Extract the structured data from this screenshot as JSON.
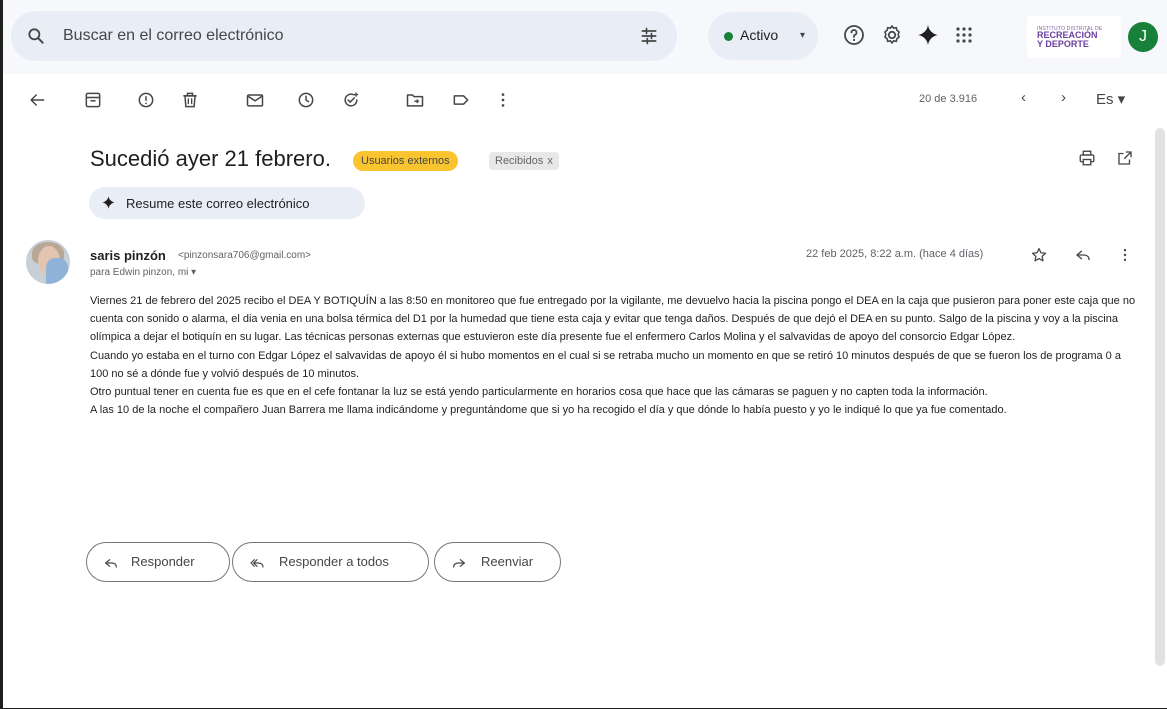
{
  "search": {
    "placeholder": "Buscar en el correo electrónico"
  },
  "status": {
    "label": "Activo",
    "color": "#188038"
  },
  "org_logo": {
    "line1": "INSTITUTO DISTRITAL DE",
    "line2": "RECREACIÓN",
    "line3": "Y DEPORTE"
  },
  "account": {
    "initial": "J",
    "color": "#188038"
  },
  "toolbar": {
    "counter": "20 de 3.916",
    "language": "Es ▾"
  },
  "email": {
    "subject": "Sucedió ayer 21 febrero.",
    "label_external": "Usuarios externos",
    "label_inbox": "Recibidos",
    "label_inbox_close": "x",
    "summary_button": "Resume este correo electrónico",
    "sender_name": "saris pinzón",
    "sender_email": "<pinzonsara706@gmail.com>",
    "recipients": "para Edwin pinzon, mi ▾",
    "date": "22 feb 2025, 8:22 a.m. (hace 4 días)",
    "body": [
      "Viernes 21 de febrero del 2025 recibo el DEA Y BOTIQUÍN a las 8:50 en monitoreo que fue entregado por la vigilante, me devuelvo hacia la piscina pongo el DEA en la caja que pusieron para poner este caja que no cuenta con sonido o alarma, el dia venia en una bolsa térmica del D1 por la humedad que tiene esta caja y evitar que tenga daños. Después de que dejó el DEA en su punto. Salgo de la piscina y voy a la piscina olímpica a dejar el botiquín en su lugar. Las técnicas personas externas que estuvieron este día presente fue el enfermero Carlos Molina y el salvavidas de apoyo del consorcio Edgar López.",
      "Cuando yo estaba en el turno con Edgar López el salvavidas de apoyo él si hubo momentos en el cual si se retraba mucho un momento en que se retiró 10 minutos después de que se fueron los de programa 0 a 100 no sé a dónde fue y volvió después de 10 minutos.",
      "Otro puntual tener en cuenta fue es que en el cefe fontanar la luz se está yendo particularmente en horarios cosa que hace que las cámaras se paguen y no capten toda la información.",
      "A las 10 de la noche el compañero Juan Barrera me llama indicándome y preguntándome que si yo ha recogido el día y que dónde lo había puesto y yo le indiqué lo que ya fue comentado."
    ],
    "label_external_color": "#f9c430"
  },
  "actions": {
    "reply": "Responder",
    "reply_all": "Responder a todos",
    "forward": "Reenviar"
  }
}
